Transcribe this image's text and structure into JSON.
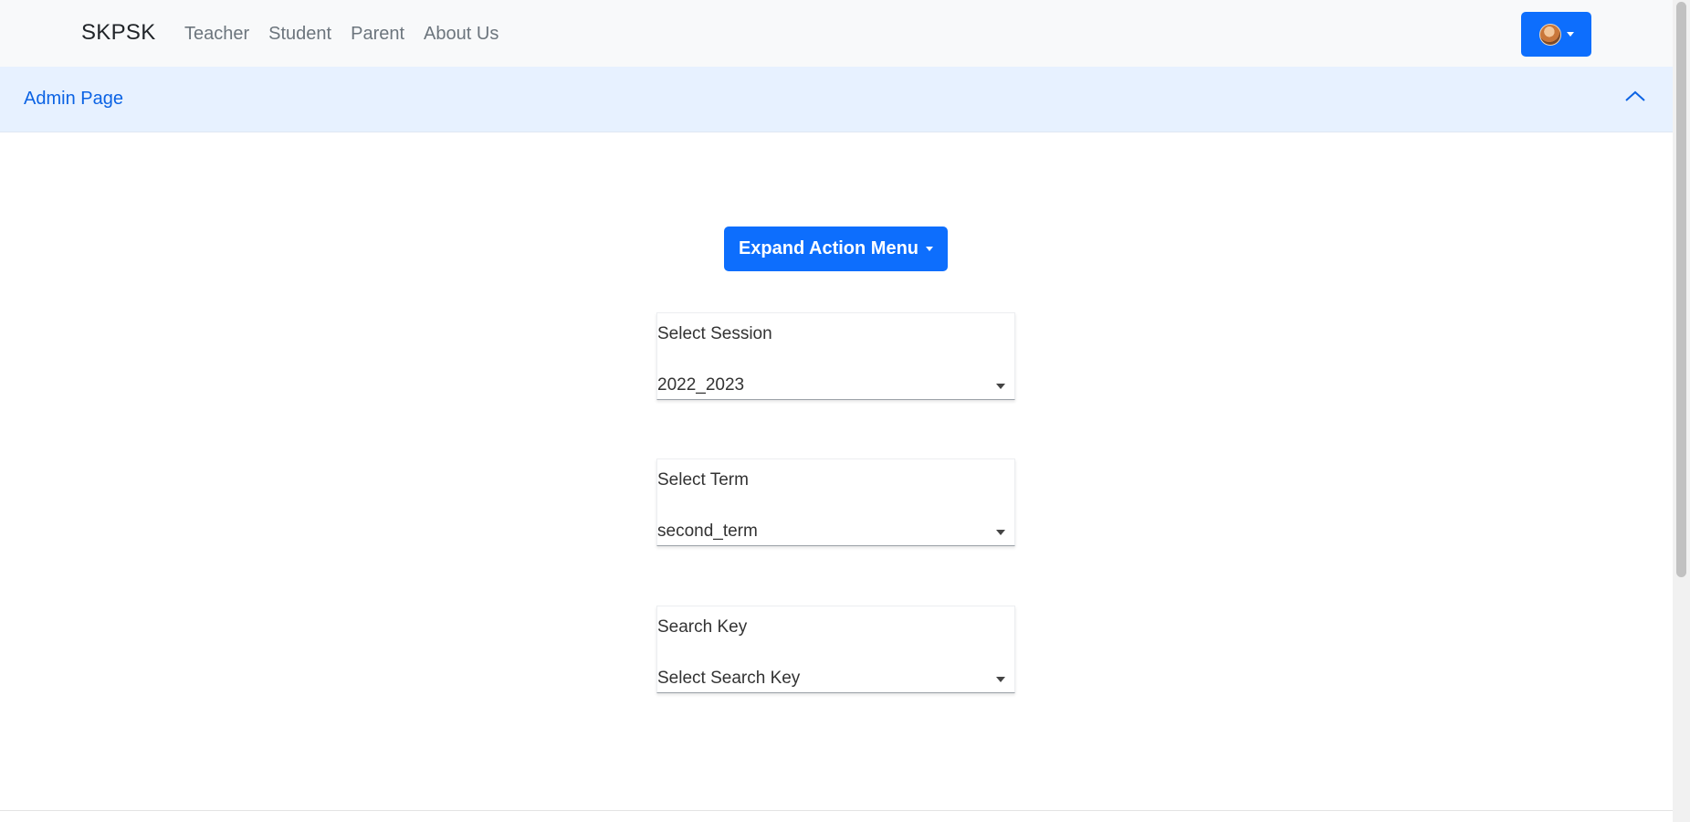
{
  "navbar": {
    "brand": "SKPSK",
    "links": [
      "Teacher",
      "Student",
      "Parent",
      "About Us"
    ]
  },
  "accordion": {
    "title": "Admin Page"
  },
  "main": {
    "action_button_label": "Expand Action Menu",
    "fields": [
      {
        "label": "Select Session",
        "value": "2022_2023"
      },
      {
        "label": "Select Term",
        "value": "second_term"
      },
      {
        "label": "Search Key",
        "value": "Select Search Key"
      }
    ]
  },
  "colors": {
    "primary": "#0d6efd",
    "accordion_bg": "#e7f1ff",
    "accordion_text": "#0c63e4",
    "navbar_bg": "#f8f9fa"
  },
  "icons": {
    "user_avatar": "avatar",
    "dropdown": "caret-down-icon",
    "accordion_toggle": "chevron-up-icon"
  }
}
